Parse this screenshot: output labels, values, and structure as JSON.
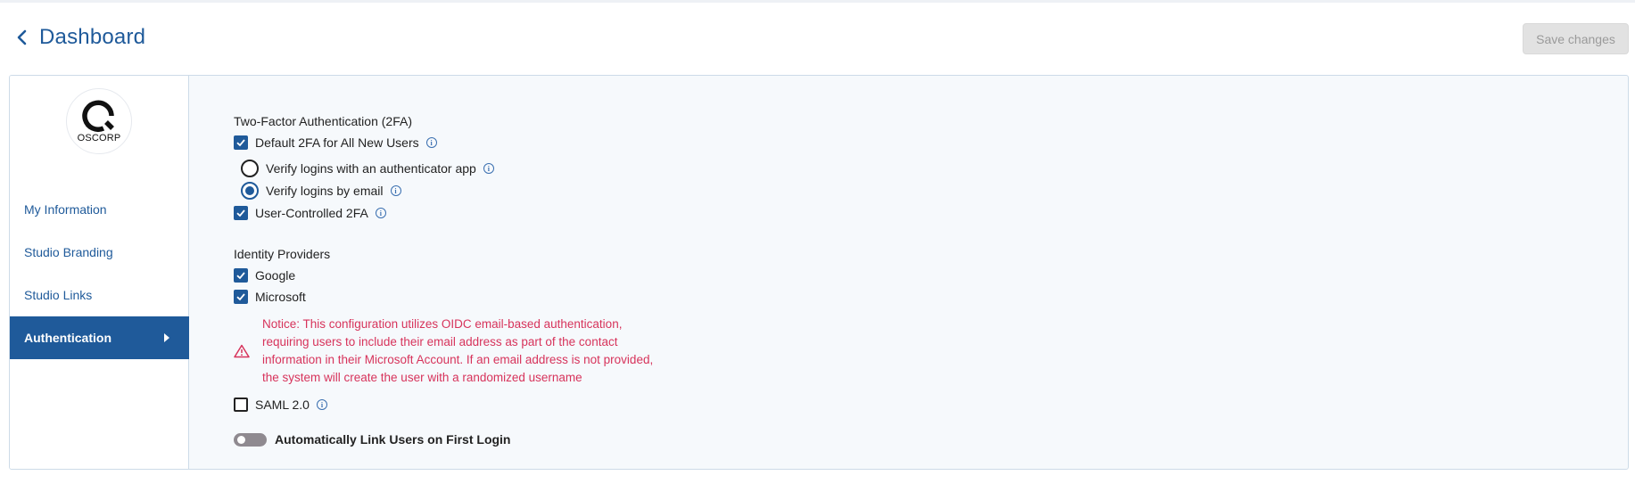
{
  "header": {
    "back_label": "Dashboard",
    "save_label": "Save changes"
  },
  "logo": {
    "text": "OSCORP"
  },
  "sidebar": {
    "items": [
      {
        "label": "My Information",
        "active": false
      },
      {
        "label": "Studio Branding",
        "active": false
      },
      {
        "label": "Studio Links",
        "active": false
      },
      {
        "label": "Authentication",
        "active": true
      }
    ]
  },
  "twofa": {
    "title": "Two-Factor Authentication (2FA)",
    "default_label": "Default 2FA for All New Users",
    "default_checked": true,
    "options": [
      {
        "label": "Verify logins with an authenticator app",
        "selected": false
      },
      {
        "label": "Verify logins by email",
        "selected": true
      }
    ],
    "user_controlled_label": "User-Controlled 2FA",
    "user_controlled_checked": true
  },
  "idp": {
    "title": "Identity Providers",
    "google_label": "Google",
    "google_checked": true,
    "microsoft_label": "Microsoft",
    "microsoft_checked": true,
    "notice": "Notice: This configuration utilizes OIDC email-based authentication, requiring users to include their email address as part of the contact information in their Microsoft Account. If an email address is not provided, the system will create the user with a randomized username",
    "saml_label": "SAML 2.0",
    "saml_checked": false
  },
  "auto_link": {
    "label": "Automatically Link Users on First Login",
    "enabled": false
  },
  "colors": {
    "primary": "#1f5a9a",
    "notice": "#d7335b",
    "toggle_off": "#8f8a90"
  }
}
